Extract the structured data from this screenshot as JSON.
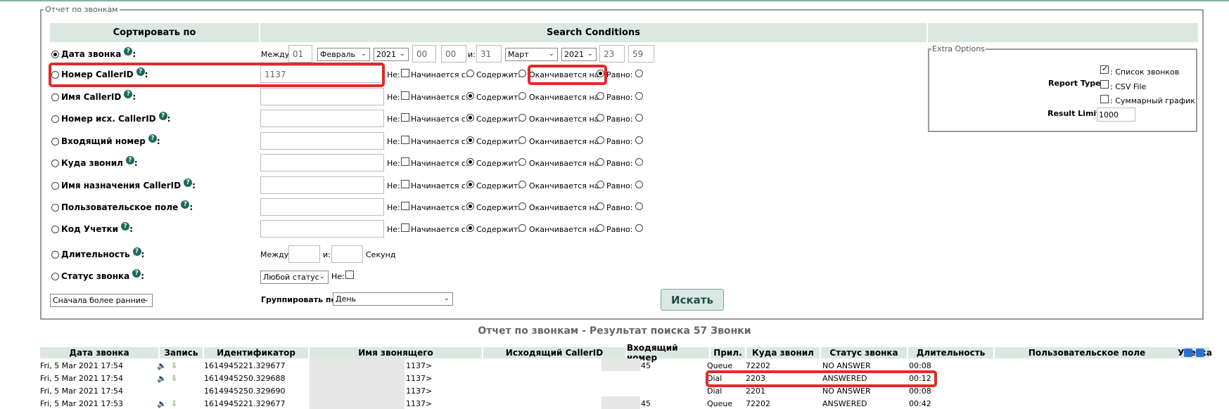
{
  "report": {
    "legend": "Отчет по звонкам"
  },
  "headers": {
    "sort_by": "Сортировать по",
    "search_conditions": "Search Conditions"
  },
  "fields": [
    {
      "label": "Дата звонка",
      "suffix": ":"
    },
    {
      "label": "Номер CallerID",
      "suffix": ":",
      "value": "1137"
    },
    {
      "label": "Имя CallerID",
      "suffix": ":"
    },
    {
      "label": "Номер исх. CallerID",
      "suffix": ":"
    },
    {
      "label": "Входящий номер",
      "suffix": ":"
    },
    {
      "label": "Куда звонил",
      "suffix": ":"
    },
    {
      "label": "Имя назначения CallerID",
      "suffix": ":"
    },
    {
      "label": "Пользовательское поле",
      "suffix": ":"
    },
    {
      "label": "Код Учетки",
      "suffix": ":"
    },
    {
      "label": "Длительность",
      "suffix": ":"
    },
    {
      "label": "Статус звонка",
      "suffix": ":"
    }
  ],
  "date_range": {
    "between_label": "Между:",
    "and_label": "и:",
    "from_day": "01",
    "from_month": "Февраль",
    "from_year": "2021",
    "from_hour": "00",
    "from_min": "00",
    "to_day": "31",
    "to_month": "Март",
    "to_year": "2021",
    "to_hour": "23",
    "to_min": "59"
  },
  "match_labels": {
    "not": "Не:",
    "starts": "Начинается с:",
    "contains": "Содержит:",
    "ends": "Оканчивается на:",
    "equals": "Равно:"
  },
  "duration": {
    "between": "Между:",
    "and": "и:",
    "unit": "Секунд"
  },
  "status": {
    "select": "Любой статус",
    "not": "Не:"
  },
  "sort_order": "Сначала более ранние",
  "group_by": {
    "label": "Группировать по:",
    "value": "День"
  },
  "search_button": "Искать",
  "extra": {
    "legend": "Extra Options",
    "report_type_label": "Report Type :",
    "opt_list": ": Список звонков",
    "opt_csv": ": CSV File",
    "opt_graph": ": Суммарный график",
    "result_limit_label": "Result Limit :",
    "result_limit": "1000"
  },
  "results_title": "Отчет по звонкам - Результат поиска 57 Звонки",
  "columns": [
    "Дата звонка",
    "Запись",
    "Идентификатор",
    "Имя звонящего",
    "Исходящий CallerID",
    "Входящий номер",
    "Прил.",
    "Куда звонил",
    "Статус звонка",
    "Длительность",
    "Пользовательское поле",
    "Учетка"
  ],
  "rows": [
    {
      "date": "Fri, 5 Mar 2021 17:54",
      "id": "1614945221.329677",
      "name": "1137>",
      "incoming": "45",
      "app": "Queue",
      "dst": "72202",
      "status": "NO ANSWER",
      "dur": "00:08"
    },
    {
      "date": "Fri, 5 Mar 2021 17:54",
      "id": "1614945250.329688",
      "name": "1137>",
      "incoming": "",
      "app": "Dial",
      "dst": "2203",
      "status": "ANSWERED",
      "dur": "00:12"
    },
    {
      "date": "Fri, 5 Mar 2021 17:54",
      "id": "1614945250.329690",
      "name": "1137>",
      "incoming": "",
      "app": "Dial",
      "dst": "2201",
      "status": "NO ANSWER",
      "dur": "00:08"
    },
    {
      "date": "Fri, 5 Mar 2021 17:53",
      "id": "1614945221.329677",
      "name": "1137>",
      "incoming": "45",
      "app": "Queue",
      "dst": "72202",
      "status": "ANSWERED",
      "dur": "00:42"
    }
  ],
  "colors": {
    "header_bg": "#dbe8e2",
    "highlight": "#e02a2a",
    "help_icon": "#1a6b5c"
  }
}
